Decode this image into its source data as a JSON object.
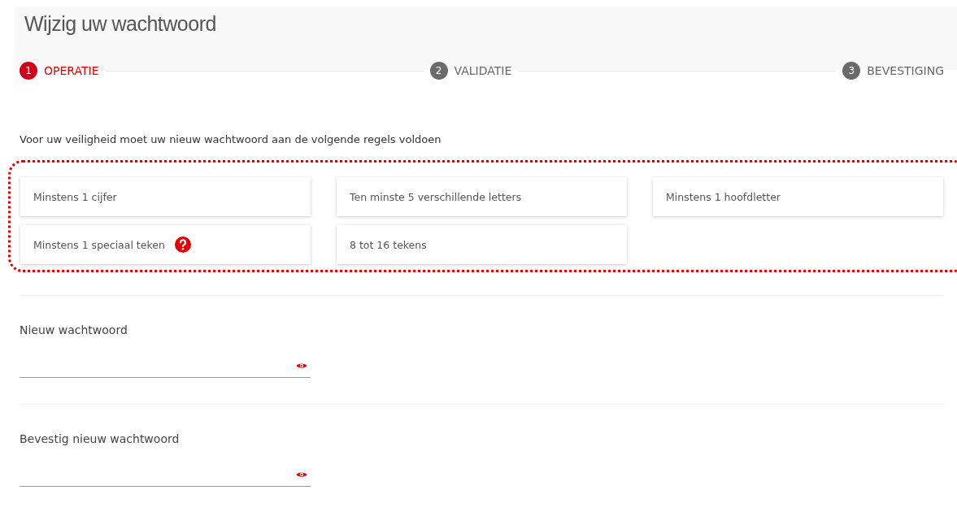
{
  "page": {
    "title": "Wijzig uw wachtwoord"
  },
  "steps": [
    {
      "number": "1",
      "label": "OPERATIE",
      "selected": true
    },
    {
      "number": "2",
      "label": "VALIDATIE",
      "selected": false
    },
    {
      "number": "3",
      "label": "BEVESTIGING",
      "selected": false
    }
  ],
  "rules_intro": "Voor uw veiligheid moet uw nieuw wachtwoord aan de volgende regels voldoen",
  "rules": [
    {
      "text": "Minstens 1 cijfer",
      "help": false
    },
    {
      "text": "Ten minste 5 verschillende letters",
      "help": false
    },
    {
      "text": "Minstens 1 hoofdletter",
      "help": false
    },
    {
      "text": "Minstens 1 speciaal teken",
      "help": true
    },
    {
      "text": "8 tot 16 tekens",
      "help": false
    }
  ],
  "fields": [
    {
      "label": "Nieuw wachtwoord"
    },
    {
      "label": "Bevestig nieuw wachtwoord"
    }
  ]
}
